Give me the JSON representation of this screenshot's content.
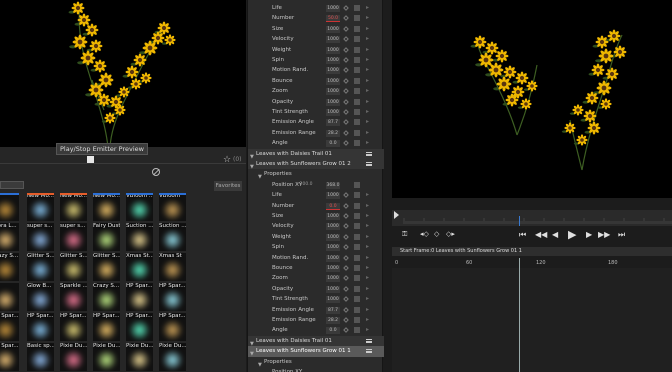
{
  "preview": {
    "tooltip": "Play/Stop Emitter Preview",
    "favorite_count": "(0)",
    "favorites_tab": "Favorites"
  },
  "presets": [
    {
      "label": "",
      "color": "#2b6fd6"
    },
    {
      "label": "New Mo...",
      "color": "#e55d2a"
    },
    {
      "label": "New Mo...",
      "color": "#e55d2a"
    },
    {
      "label": "New Mo...",
      "color": "#2b6fd6"
    },
    {
      "label": "VBloom ...",
      "color": "#2b6fd6"
    },
    {
      "label": "VBloom",
      "color": "#2b6fd6"
    },
    {
      "label": "urora L...",
      "color": ""
    },
    {
      "label": "super s...",
      "color": ""
    },
    {
      "label": "super s...",
      "color": ""
    },
    {
      "label": "Fairy Dust",
      "color": ""
    },
    {
      "label": "Suction ...",
      "color": ""
    },
    {
      "label": "Suction ...",
      "color": ""
    },
    {
      "label": "Crazy S...",
      "color": ""
    },
    {
      "label": "Glitter S...",
      "color": ""
    },
    {
      "label": "Glitter S...",
      "color": ""
    },
    {
      "label": "Glitter S...",
      "color": ""
    },
    {
      "label": "Xmas St...",
      "color": ""
    },
    {
      "label": "Xmas St",
      "color": ""
    },
    {
      "label": "",
      "color": ""
    },
    {
      "label": "Glow B...",
      "color": ""
    },
    {
      "label": "Sparkle ...",
      "color": ""
    },
    {
      "label": "Crazy S...",
      "color": ""
    },
    {
      "label": "HP Spar...",
      "color": ""
    },
    {
      "label": "HP Spar...",
      "color": ""
    },
    {
      "label": "HP Spar...",
      "color": ""
    },
    {
      "label": "HP Spar...",
      "color": ""
    },
    {
      "label": "HP Spar...",
      "color": ""
    },
    {
      "label": "HP Spar...",
      "color": ""
    },
    {
      "label": "HP Spar...",
      "color": ""
    },
    {
      "label": "HP Spar...",
      "color": ""
    },
    {
      "label": "HP Spar...",
      "color": ""
    },
    {
      "label": "Basic sp...",
      "color": ""
    },
    {
      "label": "Pixie Du...",
      "color": ""
    },
    {
      "label": "Pixie Du...",
      "color": ""
    },
    {
      "label": "Pixie Du...",
      "color": ""
    },
    {
      "label": "Pixie Du...",
      "color": ""
    }
  ],
  "properties_top": [
    {
      "name": "Life",
      "value": "1000"
    },
    {
      "name": "Number",
      "value": "50.0",
      "red": true
    },
    {
      "name": "Size",
      "value": "1000"
    },
    {
      "name": "Velocity",
      "value": "1000"
    },
    {
      "name": "Weight",
      "value": "1000"
    },
    {
      "name": "Spin",
      "value": "1000"
    },
    {
      "name": "Motion Rand.",
      "value": "1000"
    },
    {
      "name": "Bounce",
      "value": "1000"
    },
    {
      "name": "Zoom",
      "value": "1000"
    },
    {
      "name": "Opacity",
      "value": "1000"
    },
    {
      "name": "Tint Strength",
      "value": "1000"
    },
    {
      "name": "Emission Angle",
      "value": "87.7"
    },
    {
      "name": "Emission Range",
      "value": "28.2"
    },
    {
      "name": "Angle",
      "value": "0.0"
    }
  ],
  "group_daisies_1": "Leaves with Daisies Trail 01",
  "group_sunflowers_2": "Leaves with Sunflowers Grow 01 2",
  "properties_label": "Properties",
  "position_label": "Position XY",
  "position_values": [
    "-200.0",
    "368.0",
    "2560"
  ],
  "properties_bottom": [
    {
      "name": "Life",
      "value": "1000"
    },
    {
      "name": "Number",
      "value": "0.0",
      "red": true
    },
    {
      "name": "Size",
      "value": "1000"
    },
    {
      "name": "Velocity",
      "value": "1000"
    },
    {
      "name": "Weight",
      "value": "1000"
    },
    {
      "name": "Spin",
      "value": "1000"
    },
    {
      "name": "Motion Rand.",
      "value": "1000"
    },
    {
      "name": "Bounce",
      "value": "1000"
    },
    {
      "name": "Zoom",
      "value": "1000"
    },
    {
      "name": "Opacity",
      "value": "1000"
    },
    {
      "name": "Tint Strength",
      "value": "1000"
    },
    {
      "name": "Emission Angle",
      "value": "87.7"
    },
    {
      "name": "Emission Range",
      "value": "28.2"
    },
    {
      "name": "Angle",
      "value": "0.0"
    }
  ],
  "group_daisies_2": "Leaves with Daisies Trail 01",
  "group_sunflowers_1": "Leaves with Sunflowers Grow 01 1",
  "properties_label_2": "Properties",
  "position_label_2": "Position XY",
  "timeline": {
    "track_label": "Start Frame:0 Leaves with Sunflowers Grow 01 1",
    "ticks": [
      "0",
      "60",
      "120",
      "180"
    ]
  }
}
